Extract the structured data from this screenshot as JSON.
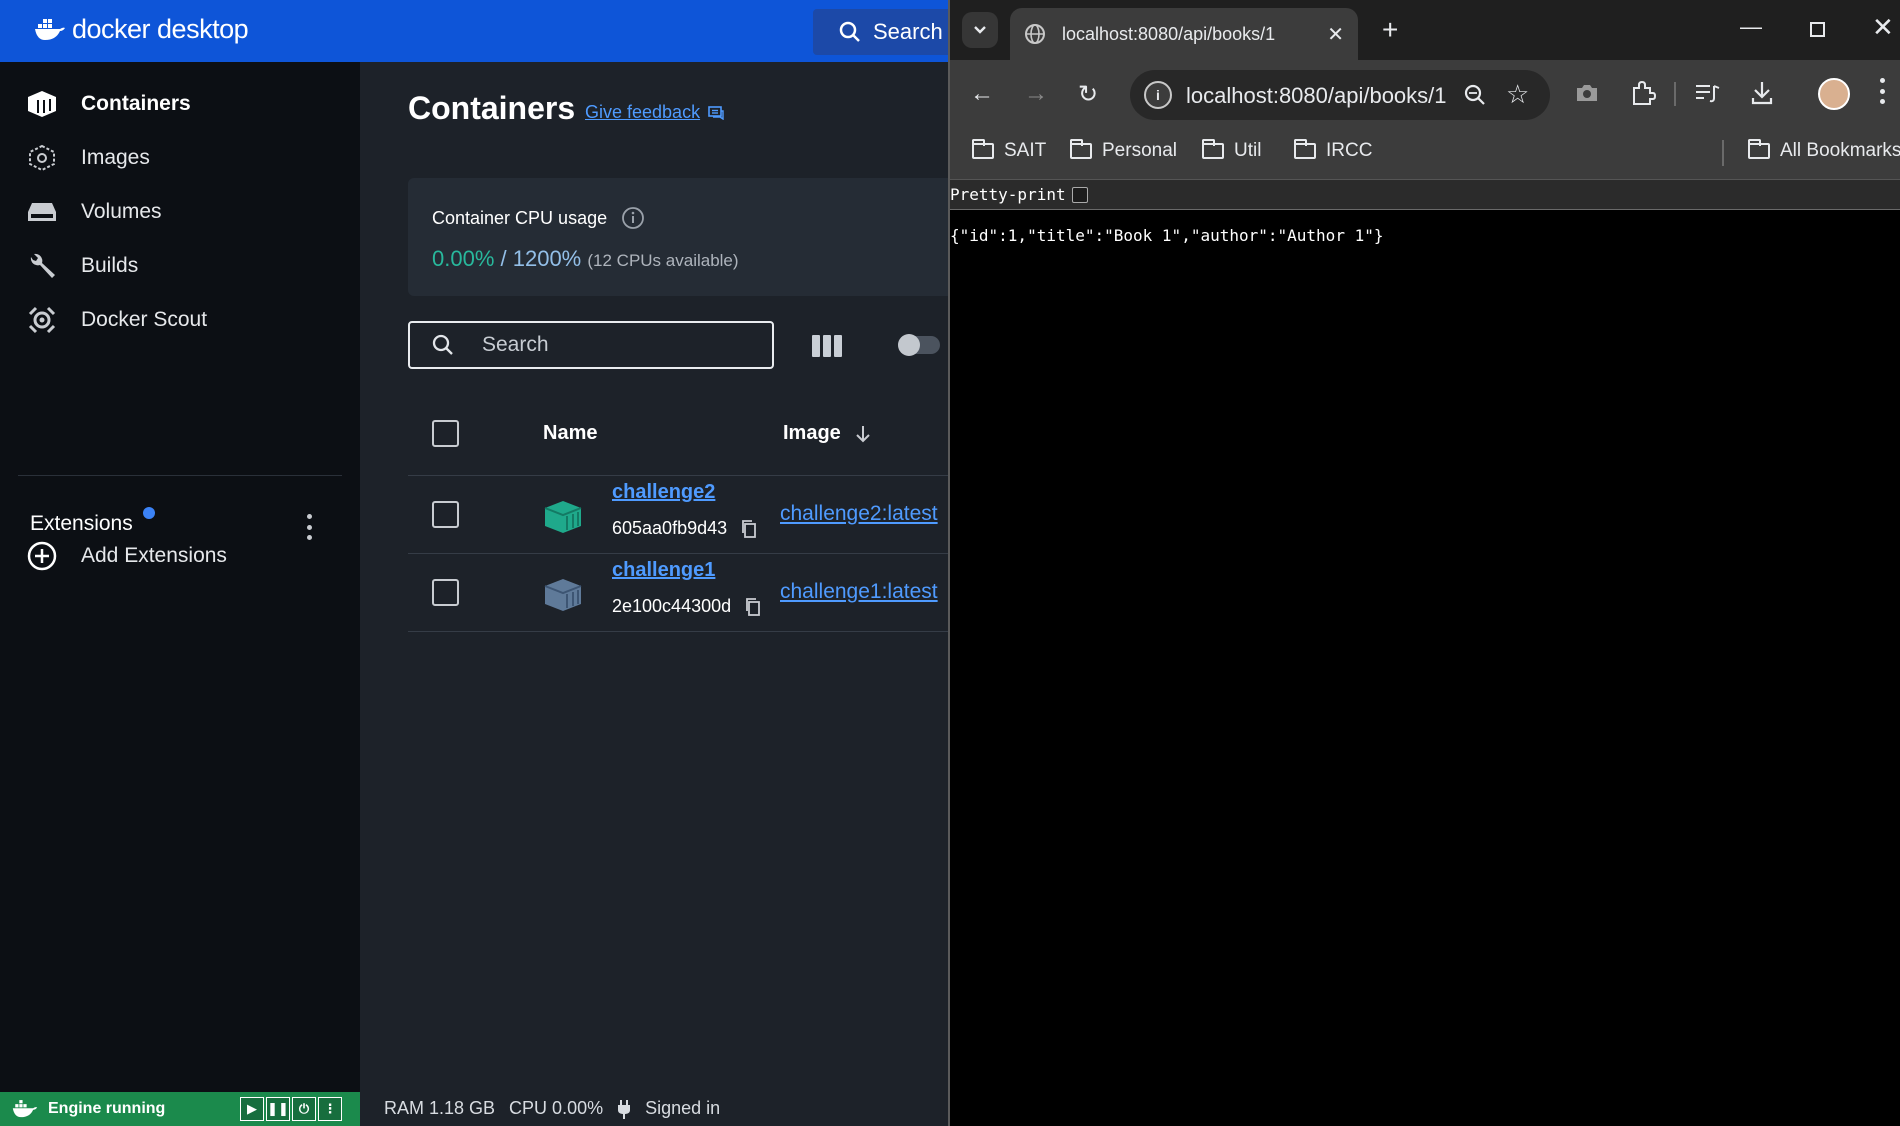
{
  "docker": {
    "app_name": "docker desktop",
    "header_search": "Search",
    "sidebar": {
      "items": [
        {
          "label": "Containers",
          "icon": "containers-icon",
          "active": true
        },
        {
          "label": "Images",
          "icon": "images-icon",
          "active": false
        },
        {
          "label": "Volumes",
          "icon": "volumes-icon",
          "active": false
        },
        {
          "label": "Builds",
          "icon": "builds-icon",
          "active": false
        },
        {
          "label": "Docker Scout",
          "icon": "docker-scout-icon",
          "active": false
        }
      ],
      "extensions_label": "Extensions",
      "add_extensions_label": "Add Extensions"
    },
    "main": {
      "title": "Containers",
      "feedback_link": "Give feedback",
      "cpu": {
        "label": "Container CPU usage",
        "used": "0.00%",
        "separator": " / ",
        "total": "1200%",
        "note": "(12 CPUs available)"
      },
      "search_placeholder": "Search",
      "table": {
        "headers": {
          "name": "Name",
          "image": "Image"
        },
        "rows": [
          {
            "name": "challenge2",
            "id": "605aa0fb9d43",
            "image": "challenge2:latest",
            "status": "running"
          },
          {
            "name": "challenge1",
            "id": "2e100c44300d",
            "image": "challenge1:latest",
            "status": "stopped"
          }
        ]
      }
    },
    "footer": {
      "engine_status": "Engine running",
      "ram": "RAM 1.18 GB",
      "cpu": "CPU 0.00%",
      "signed_in": "Signed in"
    },
    "colors": {
      "brand_blue": "#0e55d8",
      "running_green": "#1b8a4c",
      "link_blue": "#4f9bff"
    }
  },
  "browser": {
    "tab_title": "localhost:8080/api/books/1",
    "url": "localhost:8080/api/books/1",
    "bookmarks": [
      "SAIT",
      "Personal",
      "Util",
      "IRCC"
    ],
    "all_bookmarks": "All Bookmarks",
    "pretty_print_label": "Pretty-print",
    "json_text": "{\"id\":1,\"title\":\"Book 1\",\"author\":\"Author 1\"}"
  }
}
